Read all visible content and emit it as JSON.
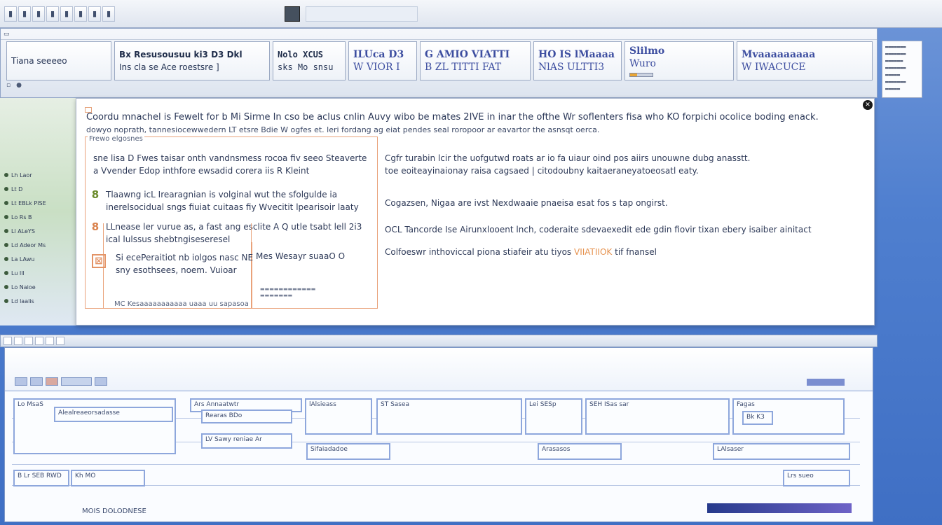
{
  "ribbon": {
    "groups": [
      {
        "l1": "",
        "l2": "Tiana  seeeeo"
      },
      {
        "l1": "Bx Resusousuu  ki3 D3 Dkl",
        "l2": "Ins cla se Ace roestsre ]"
      },
      {
        "l1": "Nolo XCUS",
        "l2": "sks Mo snsu"
      },
      {
        "l1": "ILUca D3",
        "l2": "W VIOR I"
      },
      {
        "l1": "G AMIO VIATTI",
        "l2": "B ZL TITTI FAT"
      },
      {
        "l1": "HO IS lMaaaa",
        "l2": "NlAS ULTTI3"
      },
      {
        "l1": "Slilmo",
        "l2": "Wuro"
      },
      {
        "l1": "Mvaaaaaaaaa",
        "l2": "W IWACUCE"
      }
    ],
    "progress_percent": 30
  },
  "left_items": [
    "Lh Laor",
    "Lt D",
    "Lt EBLk PISE",
    "Lo Rs B",
    "Ll ALeYS",
    "Ld Adeor Ms",
    "La LAwu",
    "Lu Ill",
    "Lo Naioe",
    "Ld laalis"
  ],
  "dialog": {
    "heading": "Coordu mnachel is Fewelt for b Mi Sirme In cso be aclus cnlin Auvy wibo be mates 2IVE in inar the ofthe Wr soflenters fisa who KO forpichi ocolice boding enack.",
    "subheading": "dowyo noprath, tannesiocewwedern LT etsre Bdie W ogfes et. leri fordang ag eiat pendes seal roropoor ar eavartor the asnsqt oerca.",
    "section_label": "Frewo elgosnes",
    "left": {
      "intro": "sne lisa D Fwes taisar onth vandnsmess rocoa fiv seeo Steaverte a Vvender Edop inthfore ewsadid corera iis R Kleint",
      "items": [
        {
          "badge": "8",
          "text": "Tlaawng icL Irearagnian is volginal wut the sfolgulde ia inerelsocidual sngs fiuiat cuitaas fiy Wvecitit lpearisoir laaty"
        },
        {
          "badge": "8",
          "text": "LLnease ler vurue as, a fast ang esclite A Q utle tsabt lell 2i3 ical lulssus shebtngiseseresel"
        }
      ],
      "inner_text": "Si ecePeraitiot nb iolgos nasc NE sny esothsees, noem. Vuioar",
      "inner_mid": "Mes Wesayr suaaO O",
      "inner_foot": "MC Kesaaaaaaaaaaa uaaa uu sapasoa"
    },
    "right": {
      "line1": "Cgfr turabin lcir the uofgutwd roats ar io fa uiaur oind pos aiirs unouwne dubg anasstt.",
      "line2": "toe eoiteayinaionay raisa cagsaed | citodoubny kaitaeraneyatoeosatl eaty.",
      "line3": "Cogazsen, Nigaa are ivst Nexdwaaie pnaeisa esat fos s tap ongirst.",
      "line4": "OCL Tancorde Ise Airunxlooent lnch, coderaite sdevaexedit ede gdin fiovir tixan ebery isaiber ainitact",
      "line5_a": "Colfoeswr inthoviccal piona stiafeir atu tiyos",
      "line5_hl": "VIIATIIOK",
      "line5_b": "tif fnansel"
    }
  },
  "bottom_window": {
    "cells": [
      "Lo MsaS",
      "Alealreaeorsadasse",
      "Ars Annaatwtr",
      "Rearas BDo",
      "LV Sawy reniae Ar",
      "lAlsieass",
      "ST Sasea",
      "Lei SESp",
      "SEH ISas sar",
      "Fagas",
      "Bk K3",
      "B Lr SEB RWD",
      "Kh MO",
      "Sifaiadadoe",
      "Arasasos",
      "LAlsaser",
      "Lrs sueo"
    ],
    "footer": "MOIS DOLODNESE"
  }
}
